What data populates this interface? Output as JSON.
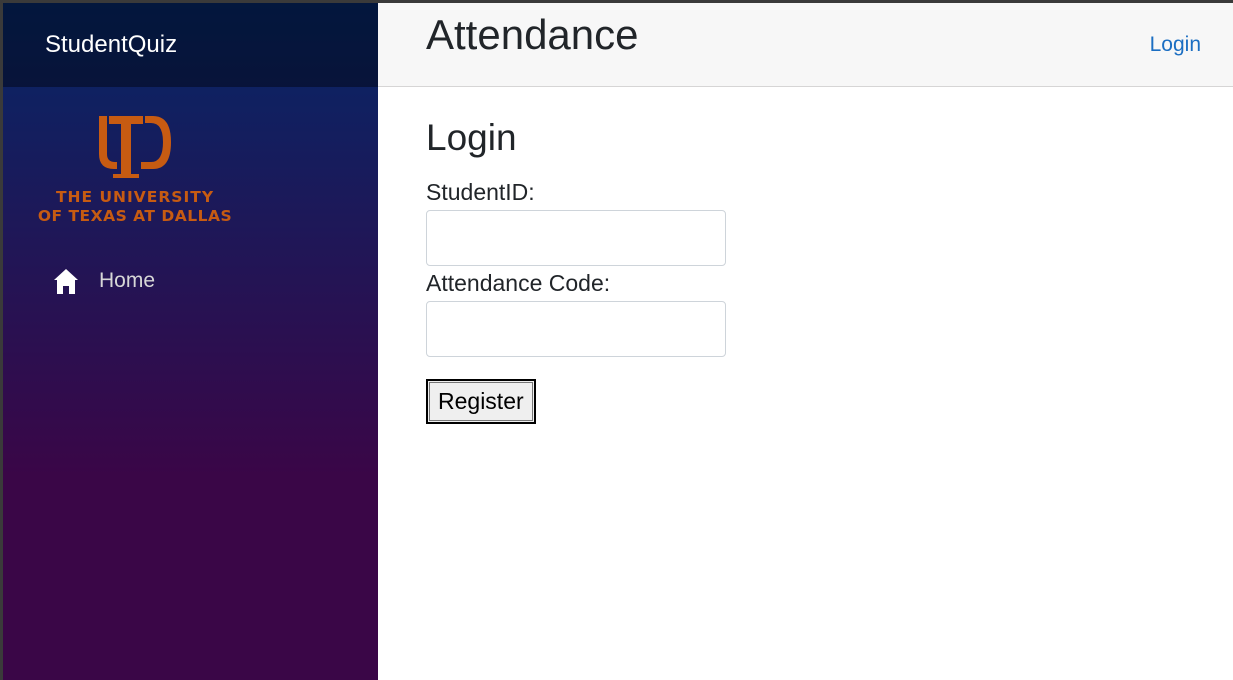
{
  "app": {
    "brand": "StudentQuiz",
    "logo": {
      "monogram": "UTD",
      "line1": "THE UNIVERSITY",
      "line2": "OF TEXAS AT DALLAS",
      "color": "#c75b12"
    }
  },
  "sidebar": {
    "items": [
      {
        "label": "Home",
        "icon": "home-icon"
      }
    ]
  },
  "header": {
    "title": "Attendance",
    "login_link": "Login"
  },
  "form": {
    "title": "Login",
    "student_id_label": "StudentID:",
    "student_id_value": "",
    "attendance_code_label": "Attendance Code:",
    "attendance_code_value": "",
    "submit_label": "Register"
  },
  "colors": {
    "sidebar_top": "#052767",
    "sidebar_bottom": "#3a0647",
    "link": "#1b6ec2",
    "header_bg": "#f7f7f7"
  }
}
